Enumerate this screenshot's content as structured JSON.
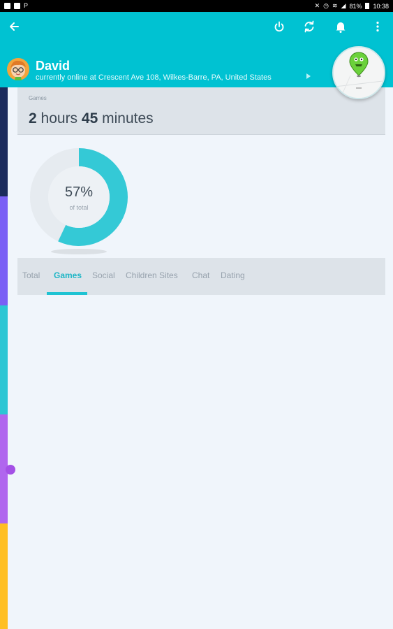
{
  "status_bar": {
    "left_icons": [
      "image-icon",
      "shirt-icon",
      "p-icon"
    ],
    "right_icons": [
      "mute-icon",
      "alarm-icon",
      "wifi-icon",
      "signal-icon"
    ],
    "battery": "81%",
    "time": "10:38"
  },
  "header": {
    "icons": [
      "arrow-left-icon",
      "power-icon",
      "refresh-icon",
      "bell-icon",
      "more-vert-icon"
    ],
    "user": {
      "name": "David",
      "status": "currently online at Crescent Ave 108, Wilkes-Barre, PA, United States"
    }
  },
  "colors": {
    "accent": "#00c2d2",
    "tab_active": "#1fb6c6",
    "strip": [
      "#1b2b5c",
      "#7a5ff5",
      "#2cc6d4",
      "#b066ee",
      "#ffbf22"
    ]
  },
  "summary": {
    "category_label": "Games",
    "hours_value": "2",
    "hours_unit": "hours",
    "minutes_value": "45",
    "minutes_unit": "minutes"
  },
  "donut": {
    "percent": 57,
    "percent_label": "57%",
    "sub_label": "of total"
  },
  "tabs": [
    {
      "label": "Total",
      "active": false
    },
    {
      "label": "Games",
      "active": true
    },
    {
      "label": "Social",
      "active": false
    },
    {
      "label": "Children Sites",
      "active": false
    },
    {
      "label": "Chat",
      "active": false
    },
    {
      "label": "Dating",
      "active": false
    }
  ]
}
